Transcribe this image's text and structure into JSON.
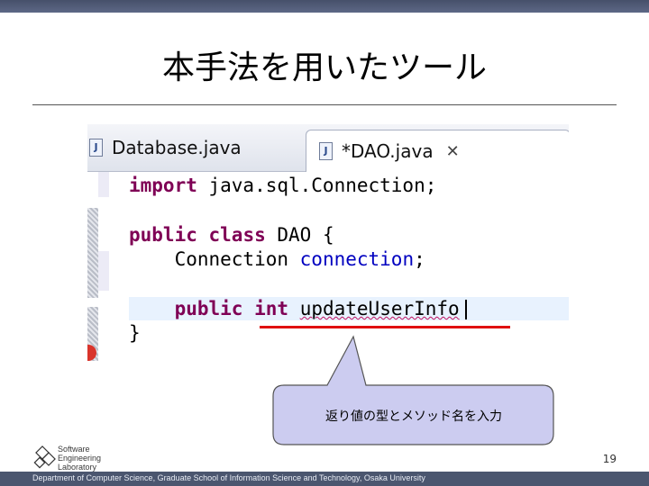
{
  "slide": {
    "title": "本手法を用いたツール",
    "page_number": "19",
    "footer": "Department of Computer Science, Graduate School of Information Science and Technology, Osaka University",
    "logo_lines": [
      "Software",
      "Engineering",
      "Laboratory"
    ]
  },
  "editor": {
    "tabs": [
      {
        "label": "Database.java",
        "icon": "java-file-icon",
        "active": false
      },
      {
        "label": "*DAO.java",
        "icon": "java-file-icon",
        "active": true,
        "close_icon": "close-icon"
      }
    ],
    "code": {
      "l1_kw": "import",
      "l1_rest": " java.sql.Connection;",
      "l2_kw1": "public",
      "l2_sp": " ",
      "l2_kw2": "class",
      "l2_rest": " DAO {",
      "l3_type": "    Connection ",
      "l3_field": "connection",
      "l3_end": ";",
      "l4_indent": "    ",
      "l4_kw1": "public",
      "l4_sp": " ",
      "l4_kw2": "int",
      "l4_sp2": " ",
      "l4_method": "updateUserInfo",
      "l5": "}"
    }
  },
  "callout": {
    "text": "返り値の型とメソッド名を入力"
  },
  "colors": {
    "keyword": "#7f0055",
    "field": "#0000c0",
    "highlight_underline": "#e01010",
    "callout_fill": "#ccccf0"
  }
}
